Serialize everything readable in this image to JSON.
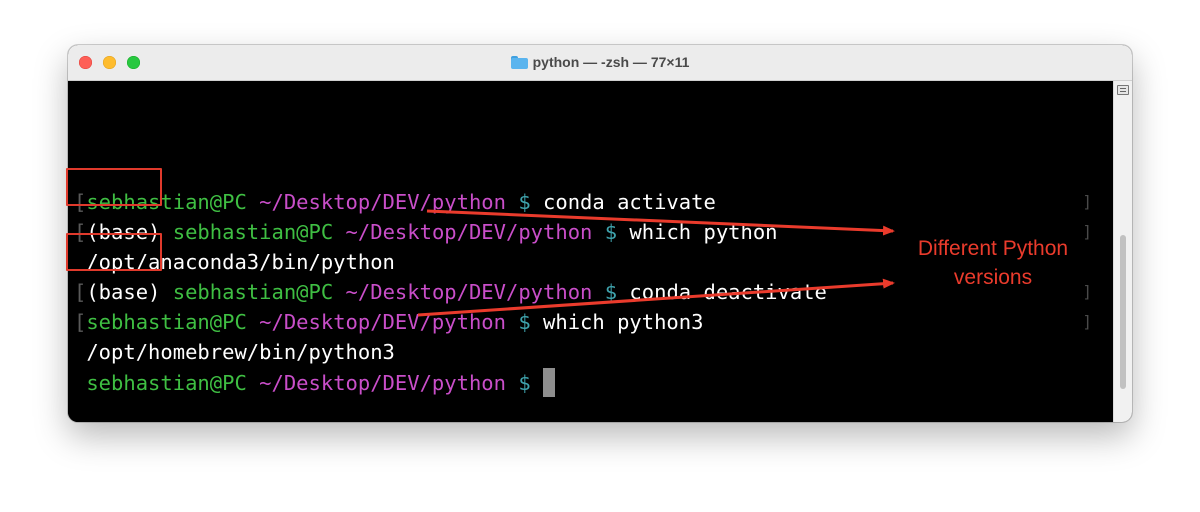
{
  "window": {
    "title": "python — -zsh — 77×11",
    "title_icon": "folder-icon"
  },
  "terminal": {
    "lines": [
      {
        "prefix": "",
        "user": "sebhastian@PC",
        "path": "~/Desktop/DEV/python",
        "prompt": "$",
        "command": "conda activate"
      },
      {
        "prefix": "(base)",
        "user": "sebhastian@PC",
        "path": "~/Desktop/DEV/python",
        "prompt": "$",
        "command": "which python"
      },
      {
        "output": "/opt/anaconda3/bin/python"
      },
      {
        "prefix": "(base)",
        "user": "sebhastian@PC",
        "path": "~/Desktop/DEV/python",
        "prompt": "$",
        "command": "conda deactivate"
      },
      {
        "prefix": "",
        "user": "sebhastian@PC",
        "path": "~/Desktop/DEV/python",
        "prompt": "$",
        "command": "which python3"
      },
      {
        "output": "/opt/homebrew/bin/python3"
      },
      {
        "prefix": "",
        "user": "sebhastian@PC",
        "path": "~/Desktop/DEV/python",
        "prompt": "$",
        "command": ""
      }
    ]
  },
  "annotation": {
    "line1": "Different Python",
    "line2": "versions",
    "color": "#ea3b2c"
  },
  "colors": {
    "user": "#3fbf43",
    "path": "#c94ec9",
    "prompt": "#3fa3ad",
    "highlight_box": "#e03a2c"
  }
}
